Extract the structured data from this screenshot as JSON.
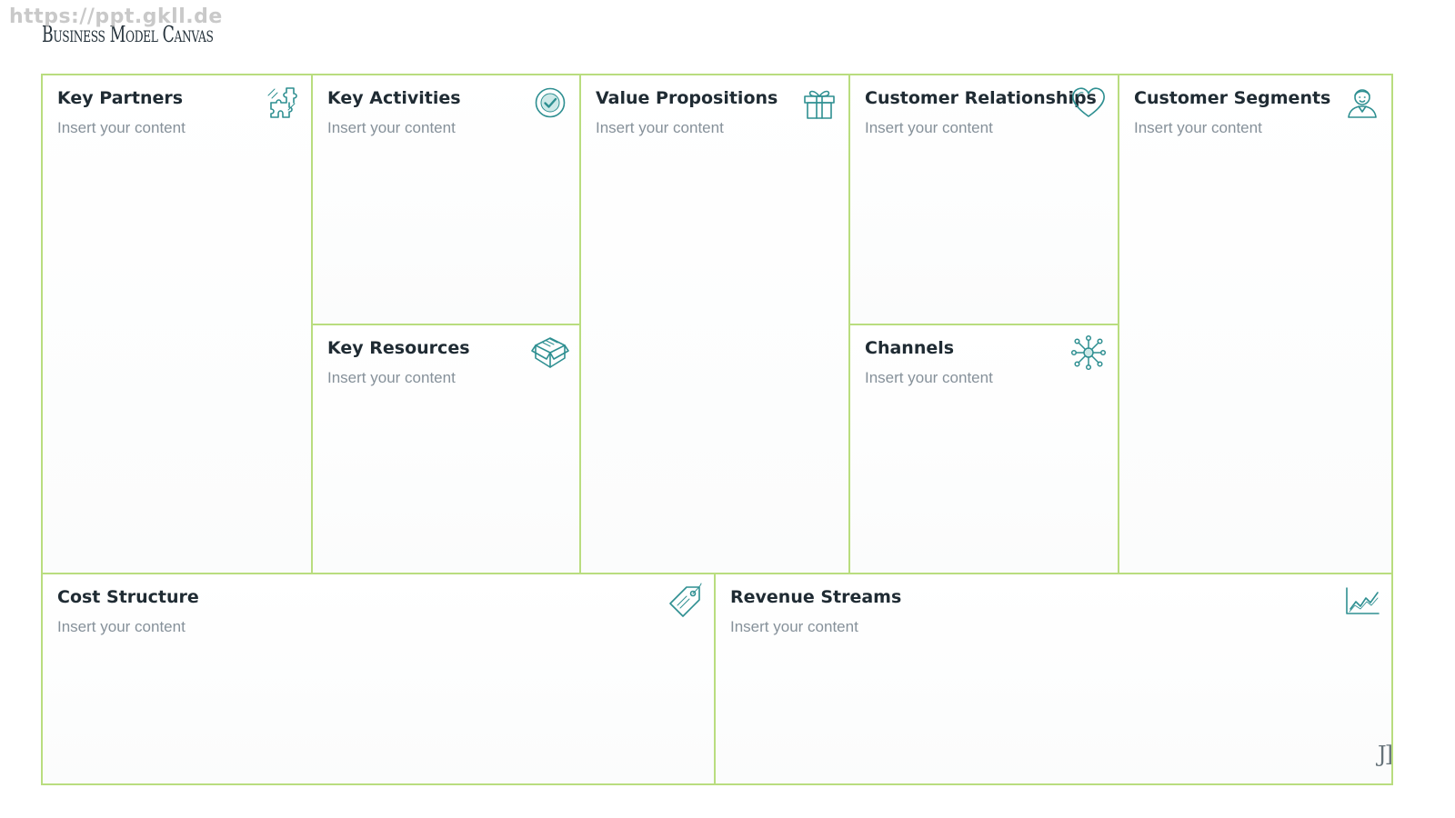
{
  "watermark": "https://ppt.gkll.de",
  "page_title": "Business Model Canvas",
  "colors": {
    "border": "#b9dd7f",
    "icon": "#2e8f91",
    "title_text": "#1f2b33",
    "content_text": "#86919a"
  },
  "blocks": {
    "key_partners": {
      "title": "Key Partners",
      "content": "Insert your content",
      "icon": "puzzle-icon"
    },
    "key_activities": {
      "title": "Key Activities",
      "content": "Insert your content",
      "icon": "check-circle-icon"
    },
    "key_resources": {
      "title": "Key Resources",
      "content": "Insert your content",
      "icon": "box-icon"
    },
    "value_propositions": {
      "title": "Value Propositions",
      "content": "Insert your content",
      "icon": "gift-icon"
    },
    "customer_relationships": {
      "title": "Customer Relationships",
      "content": "Insert your content",
      "icon": "heart-icon"
    },
    "channels": {
      "title": "Channels",
      "content": "Insert your content",
      "icon": "network-icon"
    },
    "customer_segments": {
      "title": "Customer Segments",
      "content": "Insert your content",
      "icon": "user-icon"
    },
    "cost_structure": {
      "title": "Cost Structure",
      "content": "Insert your content",
      "icon": "price-tag-icon"
    },
    "revenue_streams": {
      "title": "Revenue Streams",
      "content": "Insert your content",
      "icon": "line-chart-icon"
    }
  },
  "corner_mark": "J]"
}
